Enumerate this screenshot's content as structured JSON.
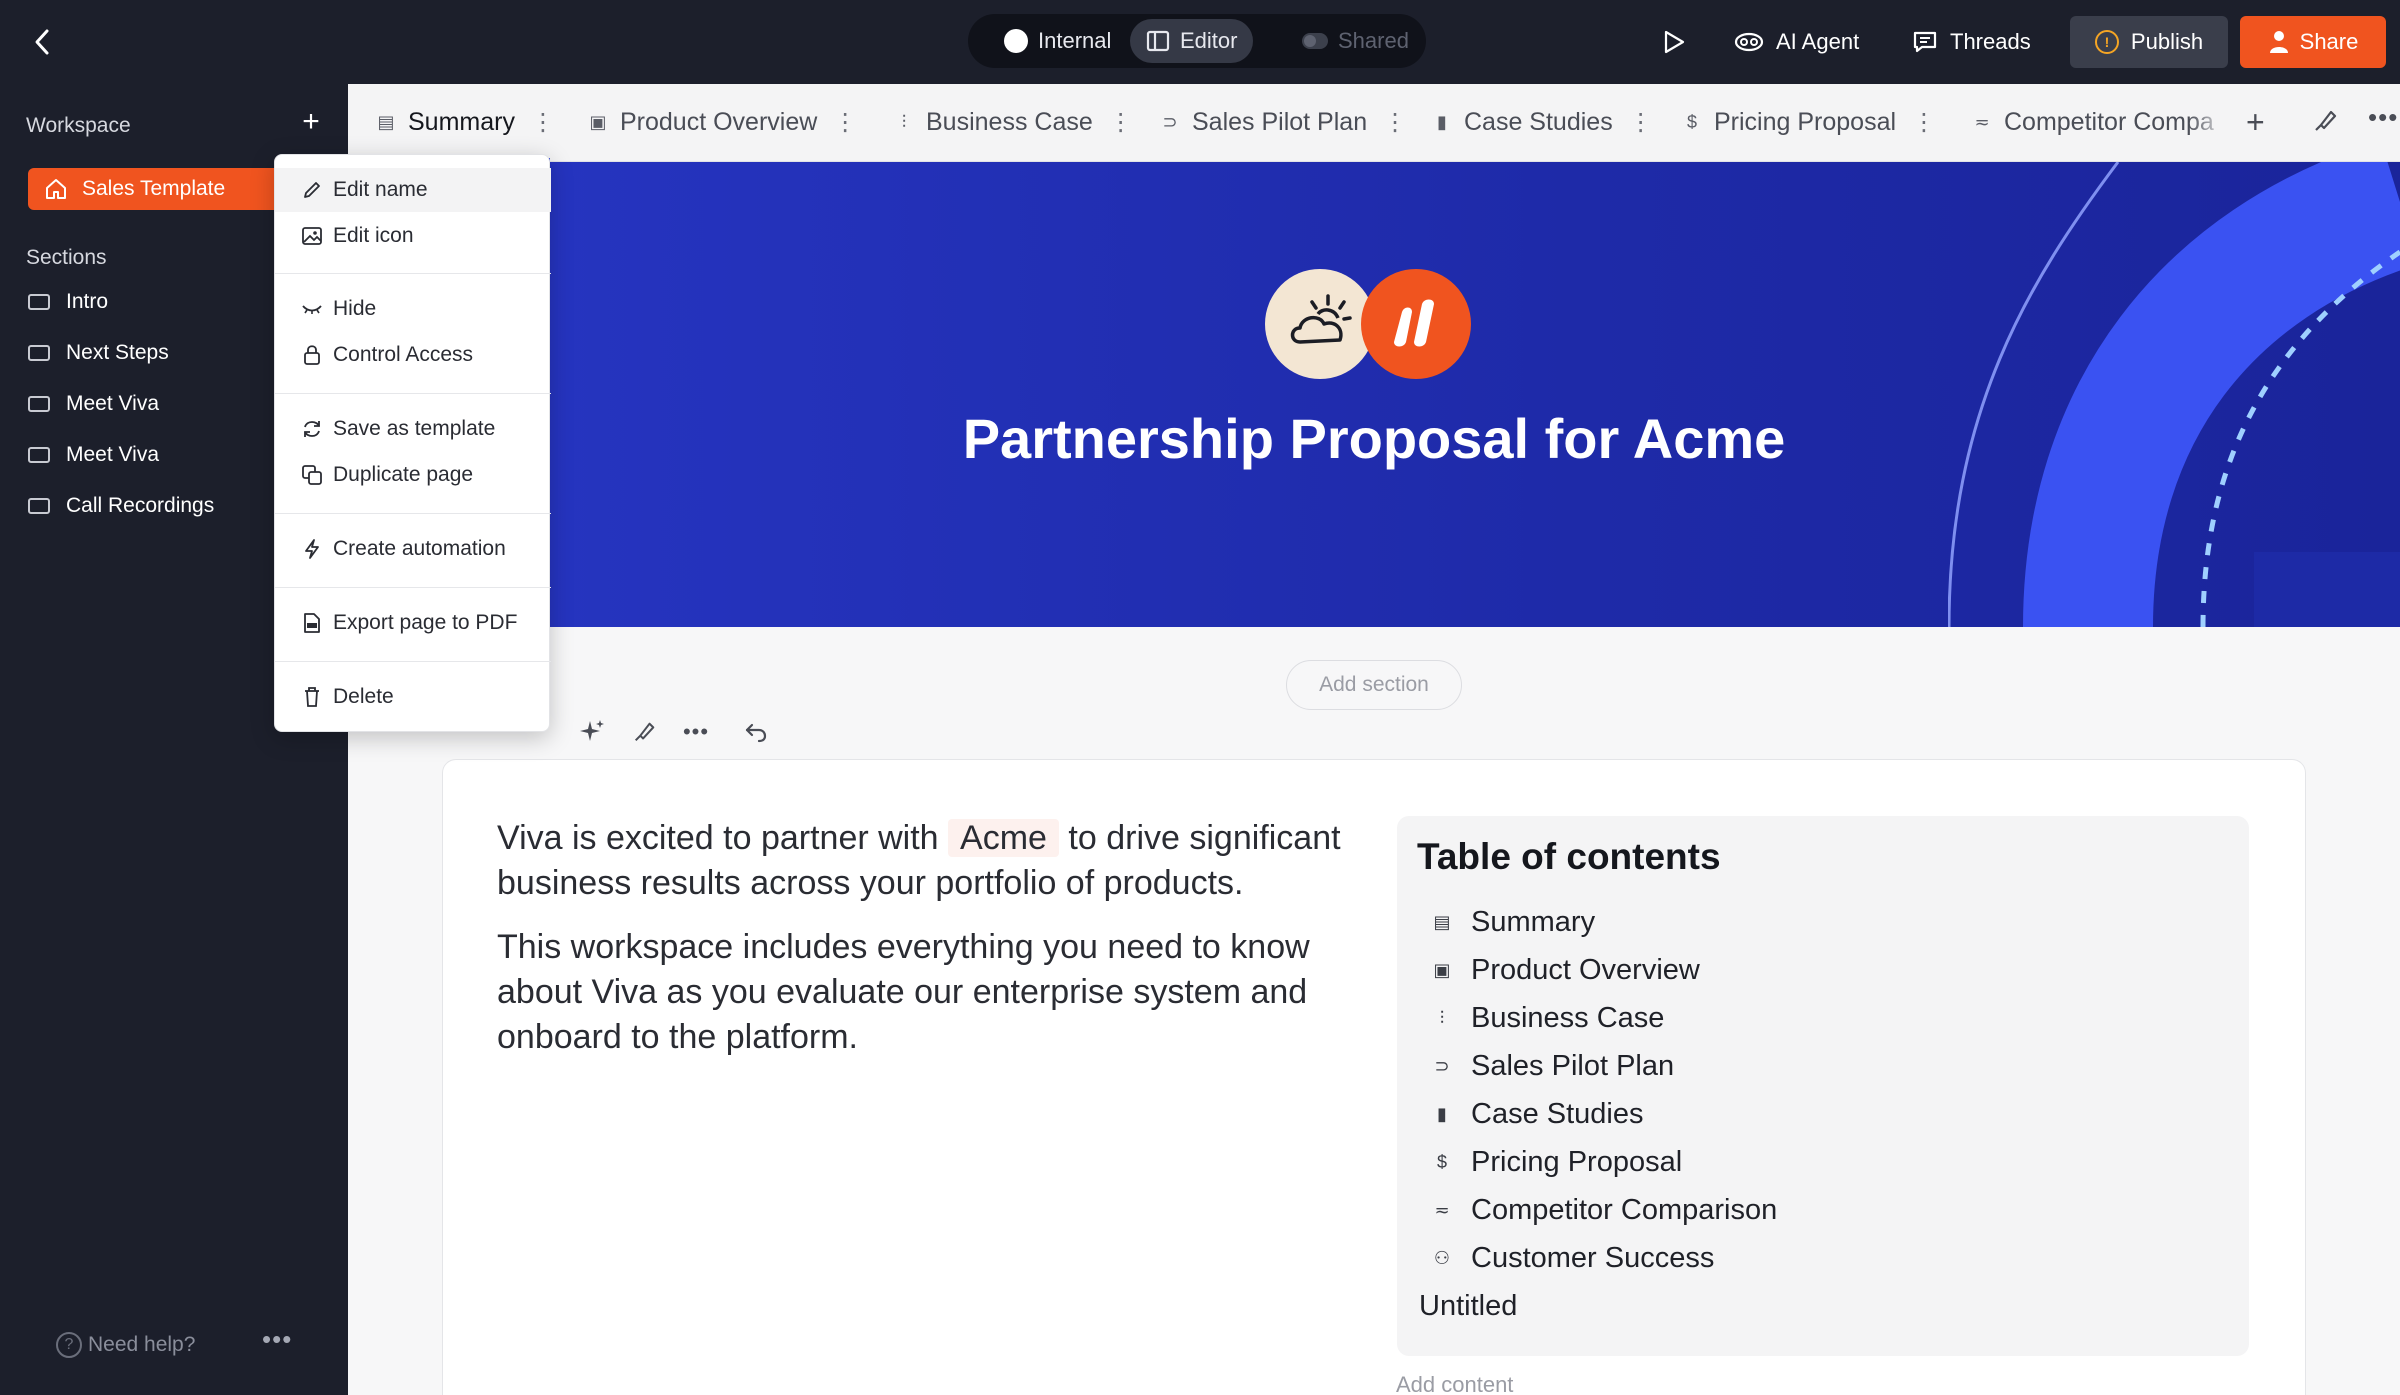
{
  "topbar": {
    "modes": [
      {
        "label": "Internal"
      },
      {
        "label": "Editor"
      },
      {
        "label": "Shared"
      }
    ],
    "ai_agent_label": "AI Agent",
    "threads_label": "Threads",
    "publish_label": "Publish",
    "share_label": "Share"
  },
  "sidebar": {
    "workspace_label": "Workspace",
    "active_template": "Sales Template",
    "sections_label": "Sections",
    "sections": [
      "Intro",
      "Next Steps",
      "Meet Viva",
      "Meet Viva",
      "Call Recordings"
    ],
    "help_label": "Need help?"
  },
  "tabs": [
    {
      "label": "Summary",
      "icon": "summary-icon",
      "active": true
    },
    {
      "label": "Product Overview",
      "icon": "product-icon"
    },
    {
      "label": "Business Case",
      "icon": "chart-icon"
    },
    {
      "label": "Sales Pilot Plan",
      "icon": "pilot-icon"
    },
    {
      "label": "Case Studies",
      "icon": "bookmark-icon"
    },
    {
      "label": "Pricing Proposal",
      "icon": "dollar-icon"
    },
    {
      "label": "Competitor Compa",
      "icon": "compare-icon"
    }
  ],
  "hero": {
    "title": "Partnership Proposal for Acme"
  },
  "main": {
    "add_section_label": "Add section",
    "section_name": "Intro",
    "intro_line1_before": "Viva is excited to partner with",
    "intro_customer": "Acme",
    "intro_line1_after": " to drive significant business results across your portfolio of products.",
    "intro_p2": "This workspace includes everything you need to know about Viva as you evaluate our enterprise system and onboard to the platform.",
    "add_content_label": "Add content"
  },
  "toc": {
    "title": "Table of contents",
    "items": [
      {
        "label": "Summary",
        "icon": "summary-icon"
      },
      {
        "label": "Product Overview",
        "icon": "product-icon"
      },
      {
        "label": "Business Case",
        "icon": "chart-icon"
      },
      {
        "label": "Sales Pilot Plan",
        "icon": "pilot-icon"
      },
      {
        "label": "Case Studies",
        "icon": "bookmark-icon"
      },
      {
        "label": "Pricing Proposal",
        "icon": "dollar-icon"
      },
      {
        "label": "Competitor Comparison",
        "icon": "compare-icon"
      },
      {
        "label": "Customer Success",
        "icon": "people-icon"
      },
      {
        "label": "Untitled",
        "icon": ""
      }
    ]
  },
  "context_menu": {
    "edit_name": "Edit name",
    "edit_icon": "Edit icon",
    "hide": "Hide",
    "control_access": "Control Access",
    "save_as_template": "Save as template",
    "duplicate_page": "Duplicate page",
    "create_automation": "Create automation",
    "export_pdf": "Export page to PDF",
    "delete": "Delete"
  },
  "colors": {
    "accent": "#f0541f",
    "hero_blue": "#2233b8",
    "dark_bg": "#1c1f2b"
  }
}
